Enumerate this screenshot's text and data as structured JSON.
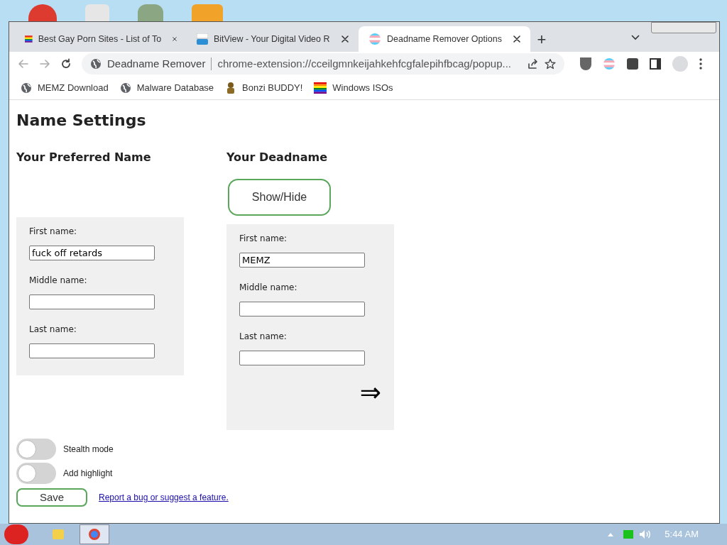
{
  "tabs": [
    {
      "title": "Best Gay Porn Sites - List of To",
      "kind": "rainbow",
      "selected": false
    },
    {
      "title": "BitView - Your Digital Video R",
      "kind": "bitview",
      "selected": false
    },
    {
      "title": "Deadname Remover Options",
      "kind": "trans",
      "selected": true
    }
  ],
  "new_tab": "+",
  "address": {
    "site": "Deadname Remover",
    "url": "chrome-extension://cceilgmnkeijahkehfcgfalepihfbcag/popup..."
  },
  "bookmarks": [
    {
      "label": "MEMZ Download",
      "kind": "globe"
    },
    {
      "label": "Malware Database",
      "kind": "globe"
    },
    {
      "label": "Bonzi BUDDY!",
      "kind": "bonzi"
    },
    {
      "label": "Windows ISOs",
      "kind": "rainbow"
    }
  ],
  "page": {
    "title": "Name Settings",
    "preferred": {
      "title": "Your Preferred Name",
      "fields": [
        {
          "label": "First name:",
          "value": "fuck off retards"
        },
        {
          "label": "Middle name:"
        },
        {
          "label": "Last name:"
        }
      ]
    },
    "deadname": {
      "title": "Your Deadname",
      "show_hide": "Show/Hide",
      "fields": [
        {
          "label": "First name:",
          "value": "MEMZ"
        },
        {
          "label": "Middle name:"
        },
        {
          "label": "Last name:"
        }
      ],
      "arrow": "⇒"
    },
    "toggles": [
      {
        "label": "Stealth mode",
        "on": false
      },
      {
        "label": "Add highlight",
        "on": false
      }
    ],
    "save": "Save",
    "link": "Report a bug or suggest a feature."
  },
  "taskbar": {
    "clock": "5:44 AM"
  }
}
